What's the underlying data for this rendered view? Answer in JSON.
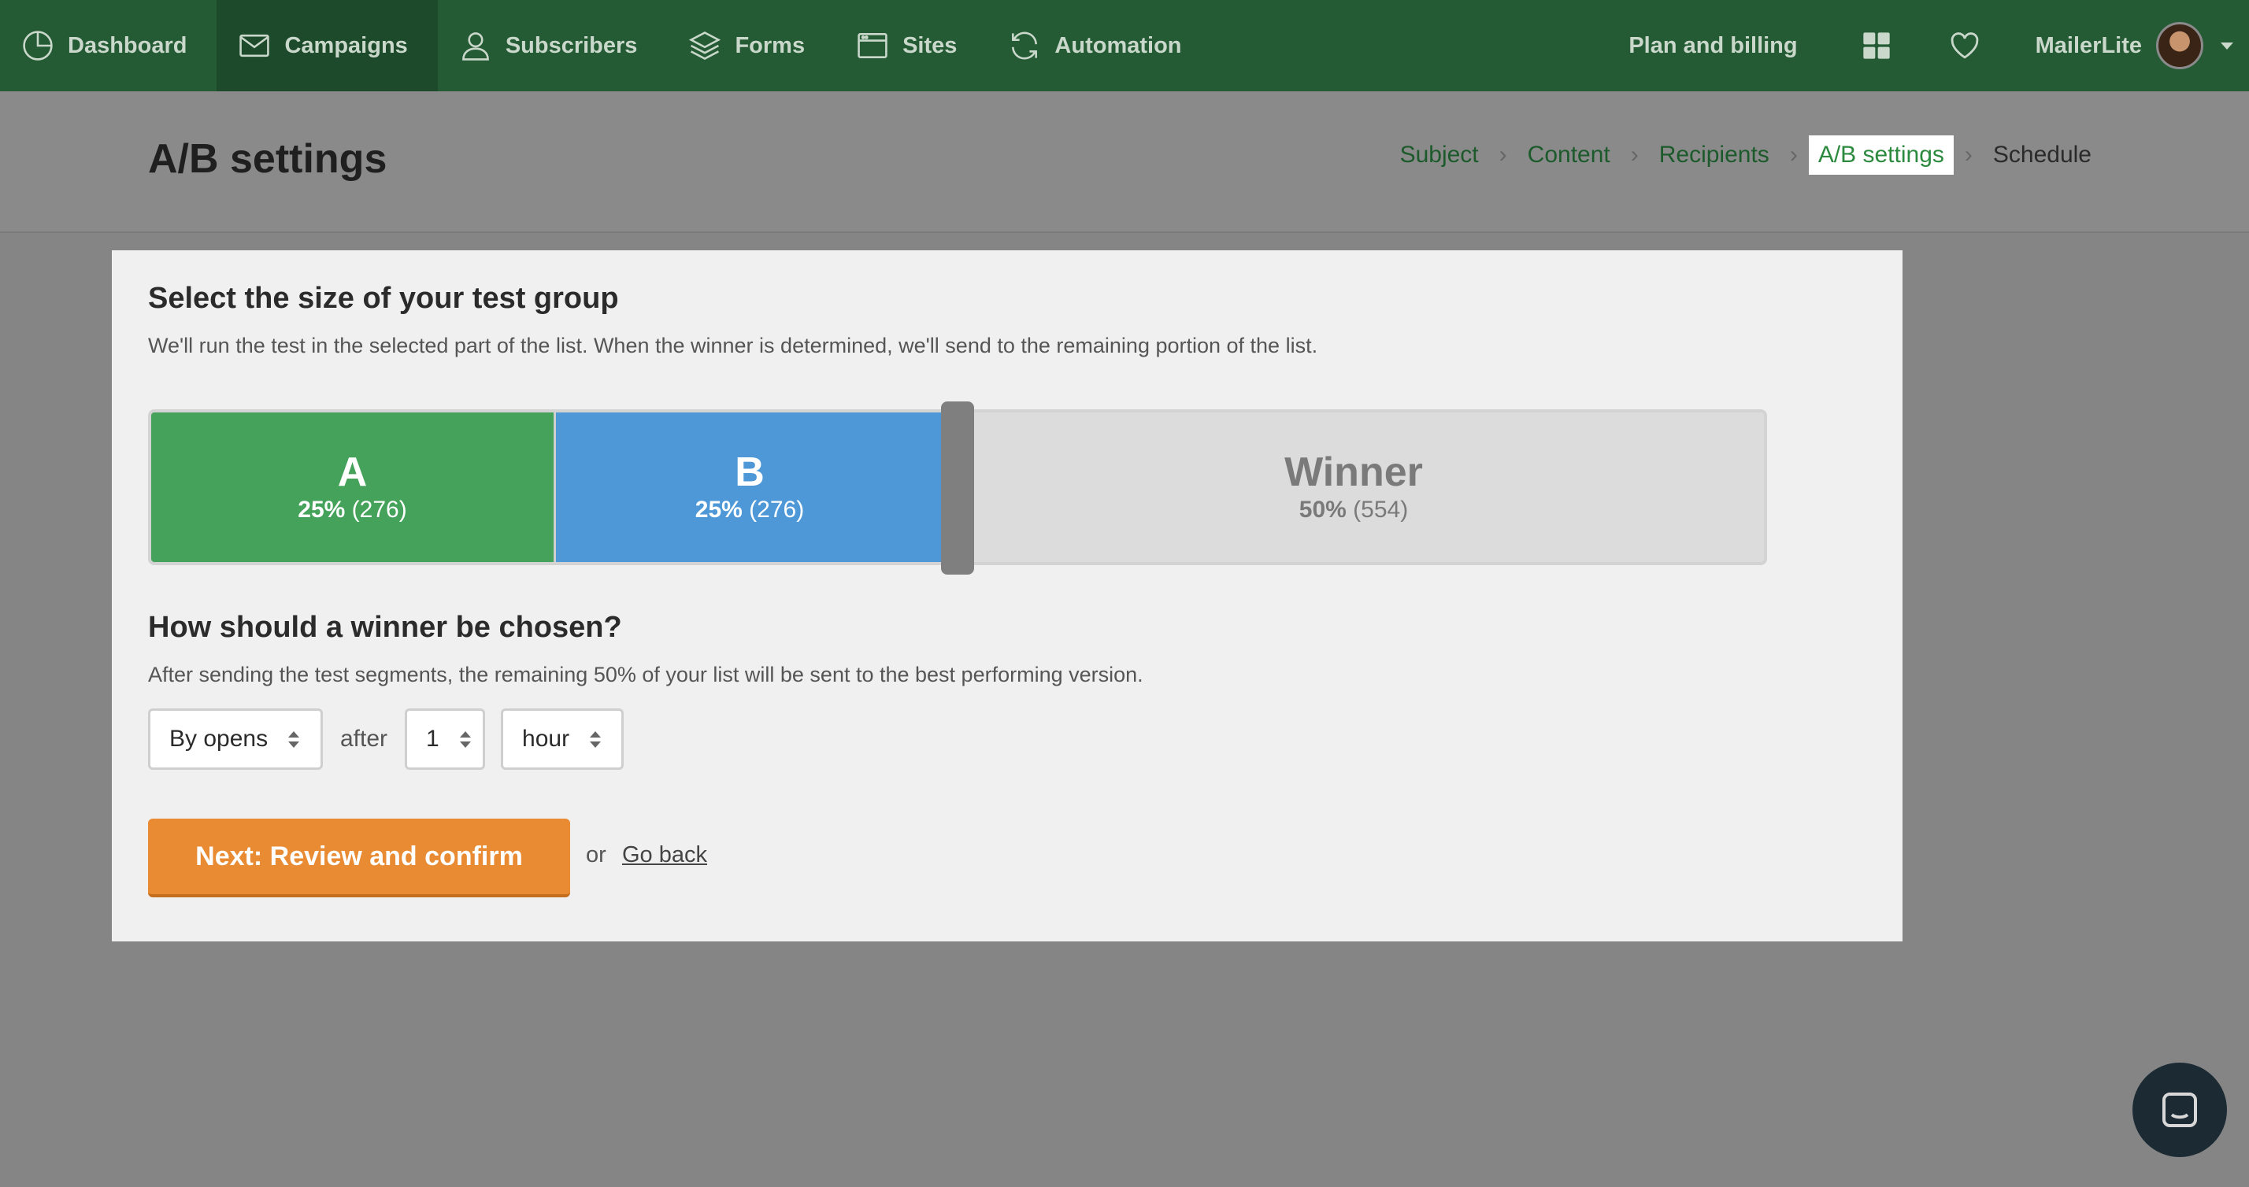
{
  "nav": {
    "items": [
      {
        "label": "Dashboard",
        "icon": "dashboard-icon"
      },
      {
        "label": "Campaigns",
        "icon": "envelope-icon",
        "active": true
      },
      {
        "label": "Subscribers",
        "icon": "user-icon"
      },
      {
        "label": "Forms",
        "icon": "layers-icon"
      },
      {
        "label": "Sites",
        "icon": "browser-window-icon"
      },
      {
        "label": "Automation",
        "icon": "refresh-icon"
      }
    ],
    "plan_billing": "Plan and billing",
    "account_name": "MailerLite"
  },
  "header": {
    "title": "A/B settings",
    "steps": [
      {
        "label": "Subject",
        "state": "done"
      },
      {
        "label": "Content",
        "state": "done"
      },
      {
        "label": "Recipients",
        "state": "done"
      },
      {
        "label": "A/B settings",
        "state": "current"
      },
      {
        "label": "Schedule",
        "state": "future"
      }
    ]
  },
  "test_group": {
    "heading": "Select the size of your test group",
    "description": "We'll run the test in the selected part of the list. When the winner is determined, we'll send to the remaining portion of the list.",
    "segments": {
      "a": {
        "letter": "A",
        "percent": "25%",
        "count": "(276)",
        "color": "#44a25a"
      },
      "b": {
        "letter": "B",
        "percent": "25%",
        "count": "(276)",
        "color": "#4e98d8"
      },
      "winner": {
        "letter": "Winner",
        "percent": "50%",
        "count": "(554)"
      }
    }
  },
  "winner": {
    "heading": "How should a winner be chosen?",
    "description": "After sending the test segments, the remaining 50% of your list will be sent to the best performing version.",
    "method": "By opens",
    "after_label": "after",
    "amount": "1",
    "unit": "hour"
  },
  "actions": {
    "next_label": "Next: Review and confirm",
    "or_label": "or",
    "back_label": "Go back"
  },
  "colors": {
    "nav_bg": "#245b34",
    "accent_orange": "#e88b32",
    "segment_a": "#44a25a",
    "segment_b": "#4e98d8"
  }
}
